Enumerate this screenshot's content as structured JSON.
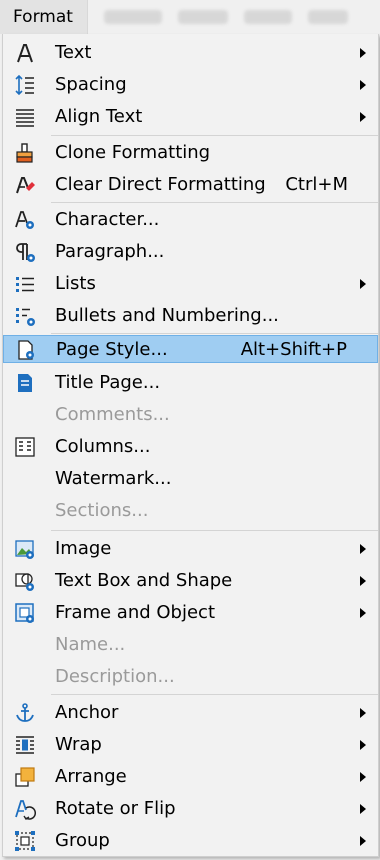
{
  "menubar": {
    "title": "Format"
  },
  "items": {
    "text": {
      "label": "Text"
    },
    "spacing": {
      "label": "Spacing"
    },
    "align_text": {
      "label": "Align Text"
    },
    "clone_formatting": {
      "label": "Clone Formatting"
    },
    "clear_direct_formatting": {
      "label": "Clear Direct Formatting",
      "shortcut": "Ctrl+M"
    },
    "character": {
      "label": "Character..."
    },
    "paragraph": {
      "label": "Paragraph..."
    },
    "lists": {
      "label": "Lists"
    },
    "bullets_numbering": {
      "label": "Bullets and Numbering..."
    },
    "page_style": {
      "label": "Page Style...",
      "shortcut": "Alt+Shift+P"
    },
    "title_page": {
      "label": "Title Page..."
    },
    "comments": {
      "label": "Comments..."
    },
    "columns": {
      "label": "Columns..."
    },
    "watermark": {
      "label": "Watermark..."
    },
    "sections": {
      "label": "Sections..."
    },
    "image": {
      "label": "Image"
    },
    "text_box_shape": {
      "label": "Text Box and Shape"
    },
    "frame_object": {
      "label": "Frame and Object"
    },
    "name": {
      "label": "Name..."
    },
    "description": {
      "label": "Description..."
    },
    "anchor": {
      "label": "Anchor"
    },
    "wrap": {
      "label": "Wrap"
    },
    "arrange": {
      "label": "Arrange"
    },
    "rotate_flip": {
      "label": "Rotate or Flip"
    },
    "group": {
      "label": "Group"
    }
  },
  "colors": {
    "highlight": "#9fcdf2",
    "disabled_text": "#9a9a9a",
    "icon_blue": "#1e6fbf"
  }
}
